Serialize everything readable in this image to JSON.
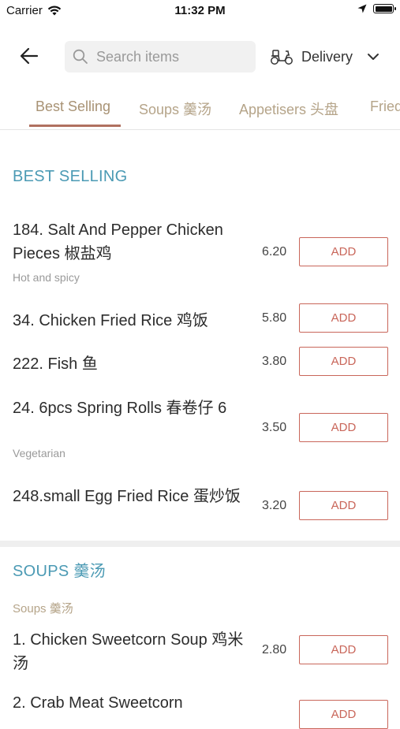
{
  "status_bar": {
    "carrier": "Carrier",
    "time": "11:32 PM"
  },
  "header": {
    "search_placeholder": "Search items",
    "delivery_label": "Delivery"
  },
  "tabs": [
    {
      "label": "Best Selling"
    },
    {
      "label": "Soups 羹汤"
    },
    {
      "label": "Appetisers 头盘"
    },
    {
      "label": "Fried"
    }
  ],
  "sections": [
    {
      "title": "BEST SELLING",
      "items": [
        {
          "name": "184. Salt And Pepper Chicken Pieces 椒盐鸡",
          "description": "Hot and spicy",
          "price": "6.20",
          "button": "ADD"
        },
        {
          "name": "34. Chicken Fried Rice 鸡饭",
          "price": "5.80",
          "button": "ADD"
        },
        {
          "name": "222. Fish 鱼",
          "price": "3.80",
          "button": "ADD"
        },
        {
          "name": "24. 6pcs Spring Rolls 春卷仔 6",
          "description": "Vegetarian",
          "price": "3.50",
          "button": "ADD"
        },
        {
          "name": "248.small Egg Fried Rice 蛋炒饭",
          "price": "3.20",
          "button": "ADD"
        }
      ]
    },
    {
      "title": "SOUPS 羹汤",
      "subtitle": "Soups 羹汤",
      "items": [
        {
          "name": "1. Chicken Sweetcorn Soup 鸡米汤",
          "price": "2.80",
          "button": "ADD"
        },
        {
          "name": "2. Crab Meat Sweetcorn",
          "button": "ADD"
        }
      ]
    }
  ],
  "colors": {
    "accent": "#c9665a",
    "section_title": "#4b9ab4",
    "tab_text": "#b5a489"
  }
}
